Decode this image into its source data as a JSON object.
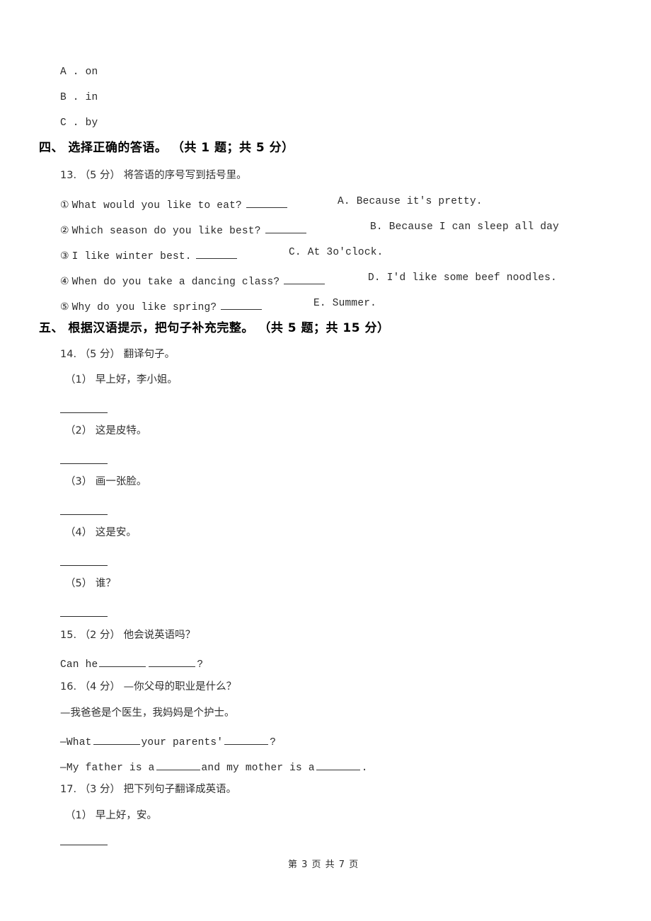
{
  "page": {
    "footer": "第 3 页 共 7 页",
    "page_number": "3",
    "total_pages": "7",
    "background_color": "#ffffff",
    "text_color": "#2a2a2a"
  },
  "carryover_options": [
    {
      "label": "A . on"
    },
    {
      "label": "B . in"
    },
    {
      "label": "C . by"
    }
  ],
  "sections": [
    {
      "id": "section-4",
      "heading": "四、  选择正确的答语。 （共 1 题；共 5 分）",
      "questions": [
        {
          "id": "q13",
          "header": "13.  （5 分）  将答语的序号写到括号里。",
          "number": "13.",
          "points": "（5 分）",
          "prompt": "将答语的序号写到括号里。",
          "match_items": [
            {
              "marker": "①",
              "text": "What would you like to eat?"
            },
            {
              "marker": "②",
              "text": "Which season do you like best?"
            },
            {
              "marker": "③",
              "text": "I like winter best."
            },
            {
              "marker": "④",
              "text": "When do you take a dancing class?"
            },
            {
              "marker": "⑤",
              "text": "Why do you like spring?"
            }
          ],
          "match_options": [
            {
              "label": "A.",
              "text": "Because it's pretty."
            },
            {
              "label": "B.",
              "text": "Because I can sleep all day"
            },
            {
              "label": "C.",
              "text": "At 3o'clock."
            },
            {
              "label": "D.",
              "text": "I'd like some beef noodles."
            },
            {
              "label": "E.",
              "text": "Summer."
            }
          ]
        }
      ]
    },
    {
      "id": "section-5",
      "heading": "五、  根据汉语提示，把句子补充完整。 （共 5 题；共 15 分）",
      "questions": [
        {
          "id": "q14",
          "header": "14.  （5 分）   翻译句子。",
          "number": "14.",
          "points": "（5 分）",
          "prompt": "翻译句子。",
          "sub_items": [
            {
              "marker": "（1）",
              "text": "早上好，李小姐。"
            },
            {
              "marker": "（2）",
              "text": "这是皮特。"
            },
            {
              "marker": "（3）",
              "text": "画一张脸。"
            },
            {
              "marker": "（4）",
              "text": "这是安。"
            },
            {
              "marker": "（5）",
              "text": "谁？"
            }
          ]
        },
        {
          "id": "q15",
          "header": "15.  （2 分）  他会说英语吗？",
          "number": "15.",
          "points": "（2 分）",
          "prompt": "他会说英语吗？",
          "answer_prefix": "Can he",
          "answer_suffix": "?"
        },
        {
          "id": "q16",
          "header": "16.  （4 分）  —你父母的职业是什么？",
          "number": "16.",
          "points": "（4 分）",
          "prompt": "—你父母的职业是什么？",
          "line2": "—我爸爸是个医生，我妈妈是个护士。",
          "line3_a": "—What",
          "line3_b": "your parents'",
          "line3_c": "?",
          "line4_a": "—My father is a",
          "line4_b": "and my mother is a",
          "line4_c": "."
        },
        {
          "id": "q17",
          "header": "17.  （3 分）  把下列句子翻译成英语。",
          "number": "17.",
          "points": "（3 分）",
          "prompt": "把下列句子翻译成英语。",
          "sub_items": [
            {
              "marker": "（1）",
              "text": "早上好，安。"
            }
          ]
        }
      ]
    }
  ]
}
